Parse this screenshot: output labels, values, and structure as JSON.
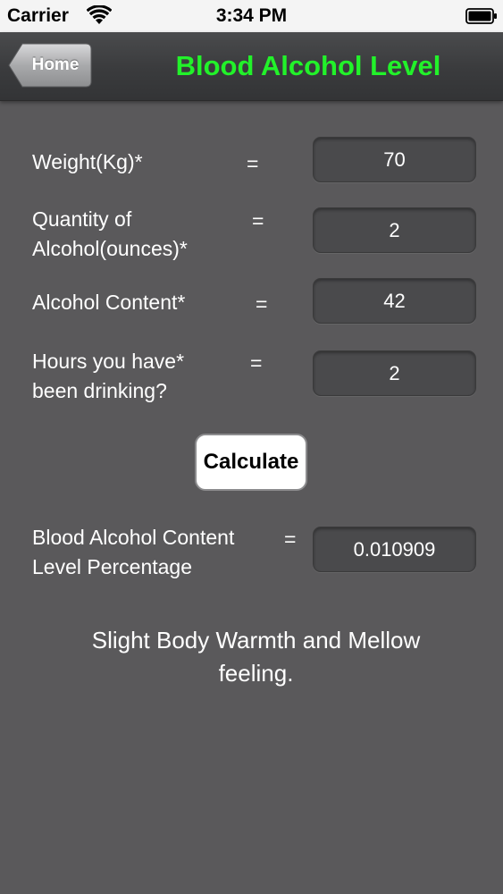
{
  "status_bar": {
    "carrier": "Carrier",
    "time": "3:34 PM",
    "wifi_icon": "wifi-icon",
    "battery_icon": "battery-icon"
  },
  "nav": {
    "back_label": "Home",
    "title": "Blood Alcohol Level",
    "title_color": "#22f22a"
  },
  "form": {
    "weight": {
      "label": "Weight(Kg)*",
      "value": "70"
    },
    "quantity": {
      "label_line1": "Quantity of",
      "label_line2": "Alcohol(ounces)*",
      "value": "2"
    },
    "content": {
      "label": "Alcohol Content*",
      "value": "42"
    },
    "hours": {
      "label_line1": "Hours you have*",
      "label_line2": "been drinking?",
      "value": "2"
    },
    "equals": "="
  },
  "calculate_label": "Calculate",
  "result": {
    "label_line1": "Blood Alcohol Content",
    "label_line2": "Level Percentage",
    "value": "0.010909",
    "message_line1": "Slight Body Warmth and Mellow",
    "message_line2": "feeling."
  }
}
